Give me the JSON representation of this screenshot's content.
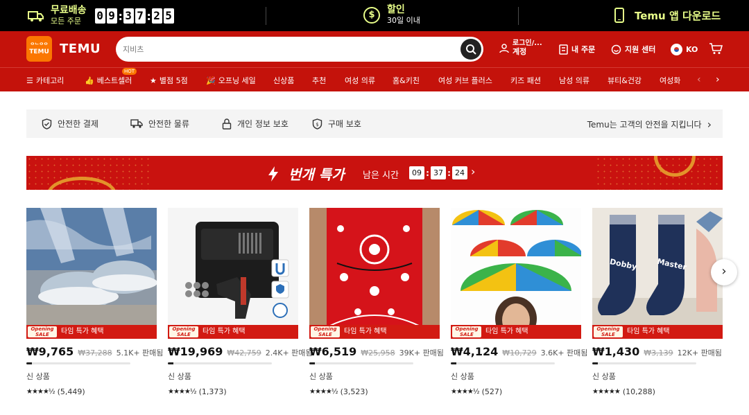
{
  "promo": {
    "free_shipping_line1": "무료배송",
    "free_shipping_line2": "모든 주문",
    "timer_digits": [
      "0",
      "9",
      "3",
      "7",
      "2",
      "5"
    ],
    "discount_line1": "할인",
    "discount_line2": "30일 이내",
    "app_download": "Temu 앱 다운로드"
  },
  "header": {
    "logo_small_line1": "ᄋᄂᄋᄋ",
    "logo_small_line2": "TEMU",
    "logo_text": "TEMU",
    "search_placeholder": "지비츠",
    "login_line1": "로그인/...",
    "login_line2": "계정",
    "orders": "내 주문",
    "support": "지원 센터",
    "language": "KO"
  },
  "nav": {
    "items": [
      "카테고리",
      "베스트셀러",
      "별점 5점",
      "오프닝 세일",
      "신상품",
      "추천",
      "여성 의류",
      "홈&키친",
      "여성 커브 플러스",
      "키즈 패션",
      "남성 의류",
      "뷰티&건강",
      "여성화"
    ],
    "hot_badge": "HOT"
  },
  "safety": {
    "items": [
      "안전한 결제",
      "안전한 물류",
      "개인 정보 보호",
      "구매 보호"
    ],
    "right_text": "Temu는 고객의 안전을 지킵니다"
  },
  "flash": {
    "title": "번개 특가",
    "label": "남은 시간",
    "hours": "09",
    "minutes": "37",
    "seconds": "24"
  },
  "products": [
    {
      "price": "₩9,765",
      "orig": "₩37,288",
      "sold": "5.1K+ 판매됨",
      "tag": "신 상품",
      "stars": "★★★★½",
      "reviews": "(5,449)",
      "sale_label": "타임 특가 혜택",
      "badge": "Opening SALE",
      "progress": 0.05
    },
    {
      "price": "₩19,969",
      "orig": "₩42,759",
      "sold": "2.4K+ 판매됨",
      "tag": "신 상품",
      "stars": "★★★★½",
      "reviews": "(1,373)",
      "sale_label": "타임 특가 혜택",
      "badge": "Opening SALE",
      "progress": 0.05
    },
    {
      "price": "₩6,519",
      "orig": "₩25,958",
      "sold": "39K+ 판매됨",
      "tag": "신 상품",
      "stars": "★★★★½",
      "reviews": "(3,523)",
      "sale_label": "타임 특가 혜택",
      "badge": "Opening SALE",
      "progress": 0.05
    },
    {
      "price": "₩4,124",
      "orig": "₩10,729",
      "sold": "3.6K+ 판매됨",
      "tag": "신 상품",
      "stars": "★★★★½",
      "reviews": "(527)",
      "sale_label": "타임 특가 혜택",
      "badge": "Opening SALE",
      "progress": 0.05
    },
    {
      "price": "₩1,430",
      "orig": "₩3,139",
      "sold": "12K+ 판매됨",
      "tag": "신 상품",
      "stars": "★★★★★",
      "reviews": "(10,288)",
      "sale_label": "타임 특가 혜택",
      "badge": "Opening SALE",
      "progress": 0.05
    }
  ],
  "colors": {
    "brand_red": "#c4120b",
    "brand_orange": "#fb7701",
    "promo_yellow": "#e9ff8a"
  }
}
